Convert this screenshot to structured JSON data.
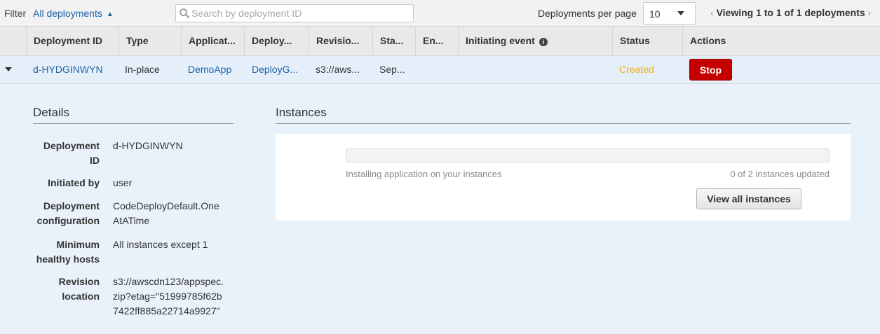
{
  "toolbar": {
    "filter_label": "Filter",
    "filter_value": "All deployments",
    "search_placeholder": "Search by deployment ID",
    "per_page_label": "Deployments per page",
    "per_page_value": "10",
    "pager_text": "Viewing 1 to 1 of 1 deployments"
  },
  "table": {
    "headers": [
      "Deployment ID",
      "Type",
      "Applicat...",
      "Deploy...",
      "Revisio...",
      "Sta...",
      "En...",
      "Initiating event",
      "Status",
      "Actions"
    ],
    "row": {
      "deployment_id": "d-HYDGINWYN",
      "type": "In-place",
      "application": "DemoApp",
      "deployment_group": "DeployG...",
      "revision": "s3://aws...",
      "start": "Sep...",
      "end": "",
      "initiating_event": "",
      "status": "Created",
      "action_label": "Stop"
    }
  },
  "details": {
    "title": "Details",
    "items": [
      {
        "label": "Deployment ID",
        "value": "d-HYDGINWYN"
      },
      {
        "label": "Initiated by",
        "value": "user"
      },
      {
        "label": "Deployment configuration",
        "value": "CodeDeployDefault.OneAtATime"
      },
      {
        "label": "Minimum healthy hosts",
        "value": "All instances except 1"
      },
      {
        "label": "Revision location",
        "value": "s3://awscdn123/appspec.zip?etag=\"51999785f62b7422ff885a22714a9927\""
      }
    ]
  },
  "instances": {
    "title": "Instances",
    "progress_status": "Installing application on your instances",
    "progress_count": "0 of 2 instances updated",
    "progress_fraction": 0,
    "view_all_label": "View all instances"
  },
  "colors": {
    "link": "#1e61a8",
    "status_created": "#f0b310",
    "stop_button": "#c40000",
    "panel_bg": "#e9f2fa"
  },
  "icons": {
    "search": "search-icon",
    "filter_toggle": "chevron-up-icon",
    "per_page_dropdown": "caret-down-icon",
    "pager_prev": "chevron-left-icon",
    "pager_next": "chevron-right-icon",
    "info": "info-icon",
    "row_expand": "caret-down-icon"
  }
}
